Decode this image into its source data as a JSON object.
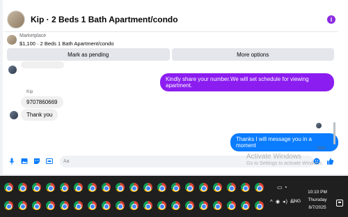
{
  "header": {
    "title": "Kip · 2 Beds 1 Bath Apartment/condo",
    "info_icon": "info-icon",
    "accent": "#8b1df0"
  },
  "marketplace": {
    "label": "Marketplace",
    "listing": "$1,100 · 2 Beds 1 Bath Apartment/condo"
  },
  "actions": {
    "pending_label": "Mark as pending",
    "more_label": "More options"
  },
  "messages": {
    "outgoing_1": "Kindly share your number.We will set schedule for viewing apartment.",
    "sender_name": "Kip",
    "incoming_1": "9707860669",
    "incoming_2": "Thank you",
    "outgoing_2": "Thanks I will message you in a moment",
    "status": "Sent"
  },
  "composer": {
    "placeholder": "Aa",
    "icons": [
      "microphone-icon",
      "photo-icon",
      "sticker-icon",
      "gif-icon",
      "emoji-icon",
      "like-icon"
    ]
  },
  "watermark": {
    "line1": "Activate Windows",
    "line2": "Go to Settings to activate Windows."
  },
  "taskbar": {
    "app_icon": "chrome-icon",
    "language": "ENG",
    "time": "10:10 PM",
    "day": "Thursday",
    "date": "8/7/2025"
  },
  "colors": {
    "outgoing_purple": "#8b1df0",
    "outgoing_blue": "#0a7cff",
    "taskbar": "#1f1f1f"
  }
}
